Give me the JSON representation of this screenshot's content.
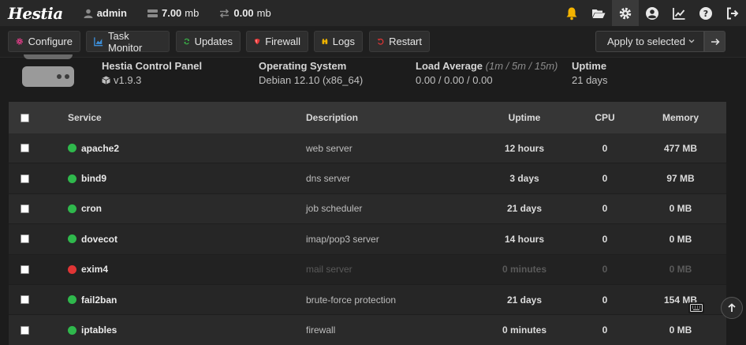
{
  "topbar": {
    "logo": "Hestia",
    "user": "admin",
    "disk_value": "7.00",
    "disk_unit": "mb",
    "bandwidth_value": "0.00",
    "bandwidth_unit": "mb",
    "icons": [
      "bell-icon",
      "folder-icon",
      "gear-icon",
      "user-icon",
      "stats-icon",
      "help-icon",
      "logout-icon"
    ]
  },
  "toolbar": {
    "configure": "Configure",
    "task_monitor": "Task Monitor",
    "updates": "Updates",
    "firewall": "Firewall",
    "logs": "Logs",
    "restart": "Restart",
    "apply_selected": "Apply to selected"
  },
  "server": {
    "panel_label": "Hestia Control Panel",
    "panel_version": "v1.9.3",
    "os_label": "Operating System",
    "os_value": "Debian 12.10 (x86_64)",
    "load_label": "Load Average",
    "load_hint": "(1m / 5m / 15m)",
    "load_value": "0.00 / 0.00 / 0.00",
    "uptime_label": "Uptime",
    "uptime_value": "21 days"
  },
  "table": {
    "headers": {
      "service": "Service",
      "description": "Description",
      "uptime": "Uptime",
      "cpu": "CPU",
      "memory": "Memory"
    },
    "rows": [
      {
        "name": "apache2",
        "description": "web server",
        "uptime": "12 hours",
        "cpu": "0",
        "memory": "477 MB",
        "status": "running"
      },
      {
        "name": "bind9",
        "description": "dns server",
        "uptime": "3 days",
        "cpu": "0",
        "memory": "97 MB",
        "status": "running"
      },
      {
        "name": "cron",
        "description": "job scheduler",
        "uptime": "21 days",
        "cpu": "0",
        "memory": "0 MB",
        "status": "running"
      },
      {
        "name": "dovecot",
        "description": "imap/pop3 server",
        "uptime": "14 hours",
        "cpu": "0",
        "memory": "0 MB",
        "status": "running"
      },
      {
        "name": "exim4",
        "description": "mail server",
        "uptime": "0 minutes",
        "cpu": "0",
        "memory": "0 MB",
        "status": "stopped"
      },
      {
        "name": "fail2ban",
        "description": "brute-force protection",
        "uptime": "21 days",
        "cpu": "0",
        "memory": "154 MB",
        "status": "running"
      },
      {
        "name": "iptables",
        "description": "firewall",
        "uptime": "0 minutes",
        "cpu": "0",
        "memory": "0 MB",
        "status": "running"
      }
    ]
  },
  "colors": {
    "running": "#2fb84c",
    "stopped": "#e03535",
    "accent_gear": "#e83e8c",
    "accent_task": "#3d8fd9",
    "accent_updates": "#3bbf4a",
    "accent_firewall": "#e03535",
    "accent_logs": "#f0b400",
    "accent_restart": "#e03535",
    "bell": "#f4b400"
  }
}
